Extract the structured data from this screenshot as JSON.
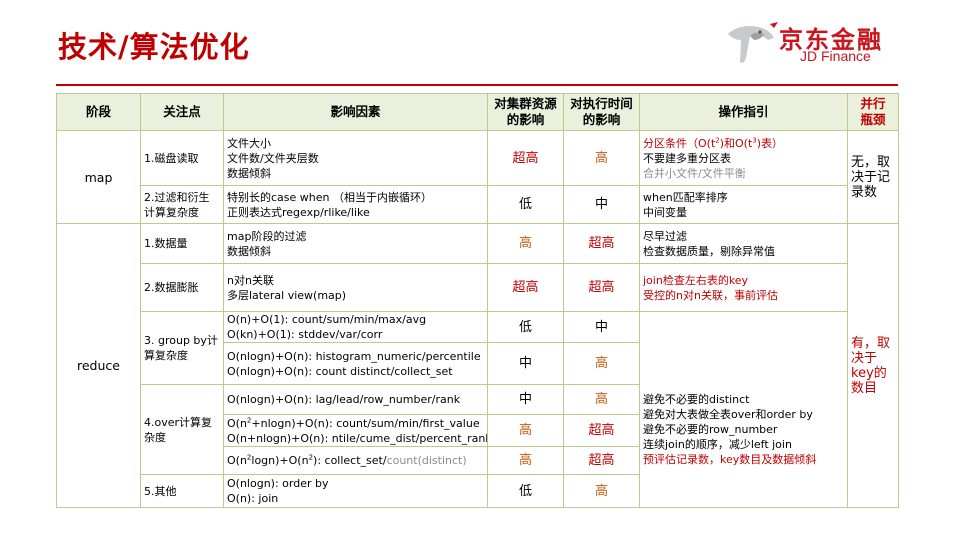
{
  "title": "技术/算法优化",
  "logo": {
    "cn": "京东金融",
    "en": "JD Finance"
  },
  "headers": {
    "stage": "阶段",
    "focus": "关注点",
    "factors": "影响因素",
    "cluster_1": "对集群资源",
    "cluster_2": "的影响",
    "time_1": "对执行时间",
    "time_2": "的影响",
    "guide": "操作指引",
    "bottleneck_1": "并行",
    "bottleneck_2": "瓶颈"
  },
  "stages": {
    "map": "map",
    "reduce": "reduce"
  },
  "rows": {
    "disk": {
      "focus": "1.磁盘读取",
      "f1": "文件大小",
      "f2": "文件数/文件夹层数",
      "f3": "数据倾斜",
      "cluster": "超高",
      "time": "高",
      "g1_pre": "分区条件（O(t",
      "g1_sup1": "2",
      "g1_mid": ")和O(t",
      "g1_sup2": "3",
      "g1_post": ")表）",
      "g2": "不要建多重分区表",
      "g3": "合并小文件/文件平衡"
    },
    "filter": {
      "focus_1": "2.过滤和衍生",
      "focus_2": "计算复杂度",
      "f1": "特别长的case when （相当于内嵌循环）",
      "f2": "正则表达式regexp/rlike/like",
      "cluster": "低",
      "time": "中",
      "g1": "when匹配率排序",
      "g2": "中间变量"
    },
    "map_bottleneck_1": "无，取",
    "map_bottleneck_2": "决于记",
    "map_bottleneck_3": "录数",
    "volume": {
      "focus": "1.数据量",
      "f1": "map阶段的过滤",
      "f2": "数据倾斜",
      "cluster": "高",
      "time": "超高",
      "g1": "尽早过滤",
      "g2": "检查数据质量，剔除异常值"
    },
    "expand": {
      "focus": "2.数据膨胀",
      "f1": "n对n关联",
      "f2": "多层lateral view(map)",
      "cluster": "超高",
      "time": "超高",
      "g1": "join检查左右表的key",
      "g2": "受控的n对n关联，事前评估"
    },
    "groupby": {
      "focus_1": "3. group by计",
      "focus_2": "算复杂度",
      "a_f1": "O(n)+O(1): count/sum/min/max/avg",
      "a_f2": "O(kn)+O(1): stddev/var/corr",
      "a_cluster": "低",
      "a_time": "中",
      "b_f1": "O(nlogn)+O(n): histogram_numeric/percentile",
      "b_f2": "O(nlogn)+O(n): count distinct/collect_set",
      "b_cluster": "中",
      "b_time": "高"
    },
    "over": {
      "focus_1": "4.over计算复",
      "focus_2": "杂度",
      "a_f1": "O(nlogn)+O(n): lag/lead/row_number/rank",
      "a_cluster": "中",
      "a_time": "高",
      "b_f1_pre": "O(n",
      "b_f1_sup": "2",
      "b_f1_post": "+nlogn)+O(n): count/sum/min/first_value",
      "b_f2": "O(n+nlogn)+O(n): ntile/cume_dist/percent_rank",
      "b_cluster": "高",
      "b_time": "超高",
      "c_f1_a": "O(n",
      "c_f1_sup1": "2",
      "c_f1_b": "logn)+O(n",
      "c_f1_sup2": "2",
      "c_f1_c": "): collect_set/",
      "c_f1_gray": "count(distinct)",
      "c_cluster": "高",
      "c_time": "超高"
    },
    "other": {
      "focus": "5.其他",
      "f1": "O(nlogn): order by",
      "f2": "O(n): join",
      "cluster": "低",
      "time": "高"
    },
    "merged_guide": {
      "g1": "避免不必要的distinct",
      "g2": "避免对大表做全表over和order  by",
      "g3": "避免不必要的row_number",
      "g4": "连续join的顺序，减少left join",
      "g5": "预评估记录数，key数目及数据倾斜"
    },
    "reduce_bottleneck_1": "有，取",
    "reduce_bottleneck_2": "决于",
    "reduce_bottleneck_3": "key的",
    "reduce_bottleneck_4": "数目"
  },
  "colors": {
    "title_red": "#c00000",
    "value_orange": "#c55a11",
    "border_green": "#b9cc8f",
    "header_bg": "#eaf0dc"
  }
}
